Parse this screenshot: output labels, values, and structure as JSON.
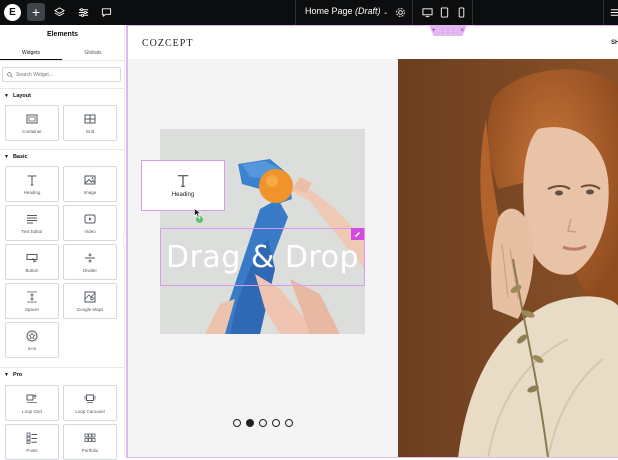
{
  "topbar": {
    "logo_letter": "E",
    "add_label": "+",
    "page_title": "Home Page",
    "page_status": "(Draft)"
  },
  "panel": {
    "title": "Elements",
    "tabs": [
      "Widgets",
      "Globals"
    ],
    "search_placeholder": "Search Widget...",
    "sections": {
      "layout": {
        "title": "Layout",
        "widgets": [
          "Container",
          "Grid"
        ]
      },
      "basic": {
        "title": "Basic",
        "widgets": [
          "Heading",
          "Image",
          "Text Editor",
          "Video",
          "Button",
          "Divider",
          "Spacer",
          "Google Maps",
          "Icon"
        ]
      },
      "pro": {
        "title": "Pro",
        "widgets": [
          "Loop Grid",
          "Loop Carousel",
          "Posts",
          "Portfolio"
        ]
      }
    }
  },
  "canvas": {
    "brand": "COZCEPT",
    "nav_partial": "SH",
    "hero_heading": "Drag & Drop",
    "drag_ghost_label": "Heading",
    "carousel_dots": 5,
    "carousel_active": 2,
    "drop_plus": "+"
  },
  "colors": {
    "topbar_bg": "#0c0d0e",
    "accent_pink": "#d24ce0",
    "badge_pink": "#e5b8f4",
    "drop_green": "#5fbf6b"
  }
}
